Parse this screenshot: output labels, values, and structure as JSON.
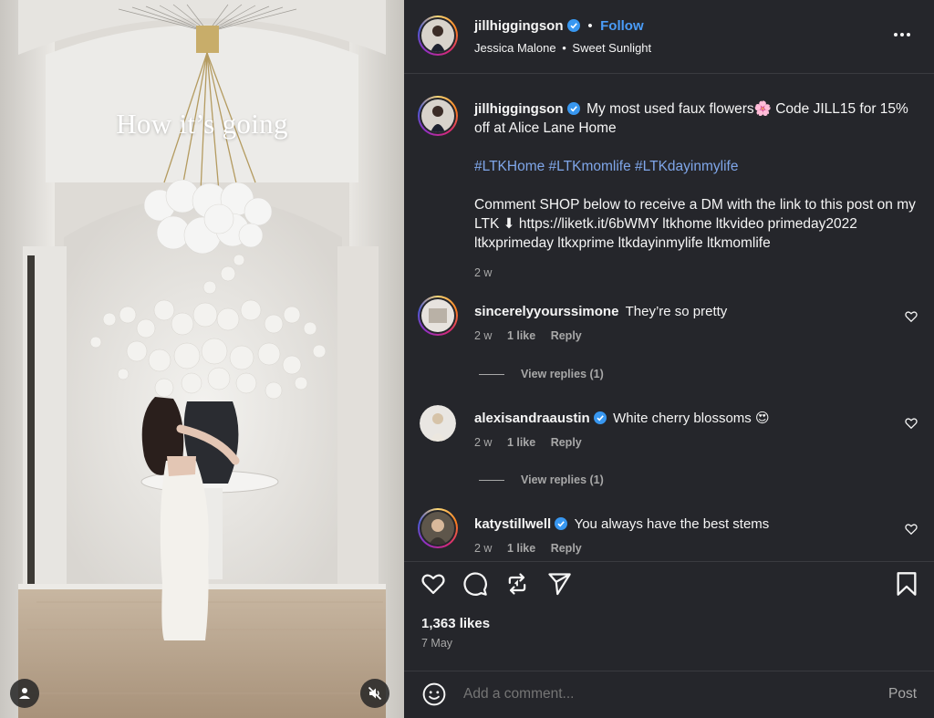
{
  "media": {
    "overlay_text": "How it’s going",
    "user_icon": "user-icon",
    "mute_icon": "muted-speaker-icon"
  },
  "header": {
    "username": "jillhiggingson",
    "follow_label": "Follow",
    "separator": "•",
    "audio_artist": "Jessica Malone",
    "audio_track": "Sweet Sunlight",
    "audio_separator": "•"
  },
  "caption": {
    "username": "jillhiggingson",
    "text": "My most used faux flowers🌸  Code JILL15 for 15% off at Alice Lane Home",
    "hashtags": "#LTKHome #LTKmomlife #LTKdayinmylife",
    "body": "Comment SHOP below to receive a DM with the link to this post on my LTK ⬇ https://liketk.it/6bWMY ltkhome ltkvideo primeday2022 ltkxprimeday ltkxprime ltkdayinmylife ltkmomlife",
    "time": "2 w"
  },
  "comments": [
    {
      "username": "sincerelyyourssimone",
      "verified": false,
      "text": "They’re so pretty",
      "time": "2 w",
      "likes": "1 like",
      "reply": "Reply",
      "view_replies": "View replies (1)"
    },
    {
      "username": "alexisandraaustin",
      "verified": true,
      "text": "White cherry blossoms 😍",
      "time": "2 w",
      "likes": "1 like",
      "reply": "Reply",
      "view_replies": "View replies (1)"
    },
    {
      "username": "katystillwell",
      "verified": true,
      "text": "You always have the best stems",
      "time": "2 w",
      "likes": "1 like",
      "reply": "Reply"
    }
  ],
  "footer": {
    "likes": "1,363 likes",
    "date": "7 May",
    "comment_placeholder": "Add a comment...",
    "post_label": "Post"
  },
  "colors": {
    "panel_bg": "#25262b",
    "follow_blue": "#4a9cf8",
    "hashtag_blue": "#7fa6e9",
    "muted_text": "#a8a8a8",
    "verified_blue": "#3897f0"
  }
}
